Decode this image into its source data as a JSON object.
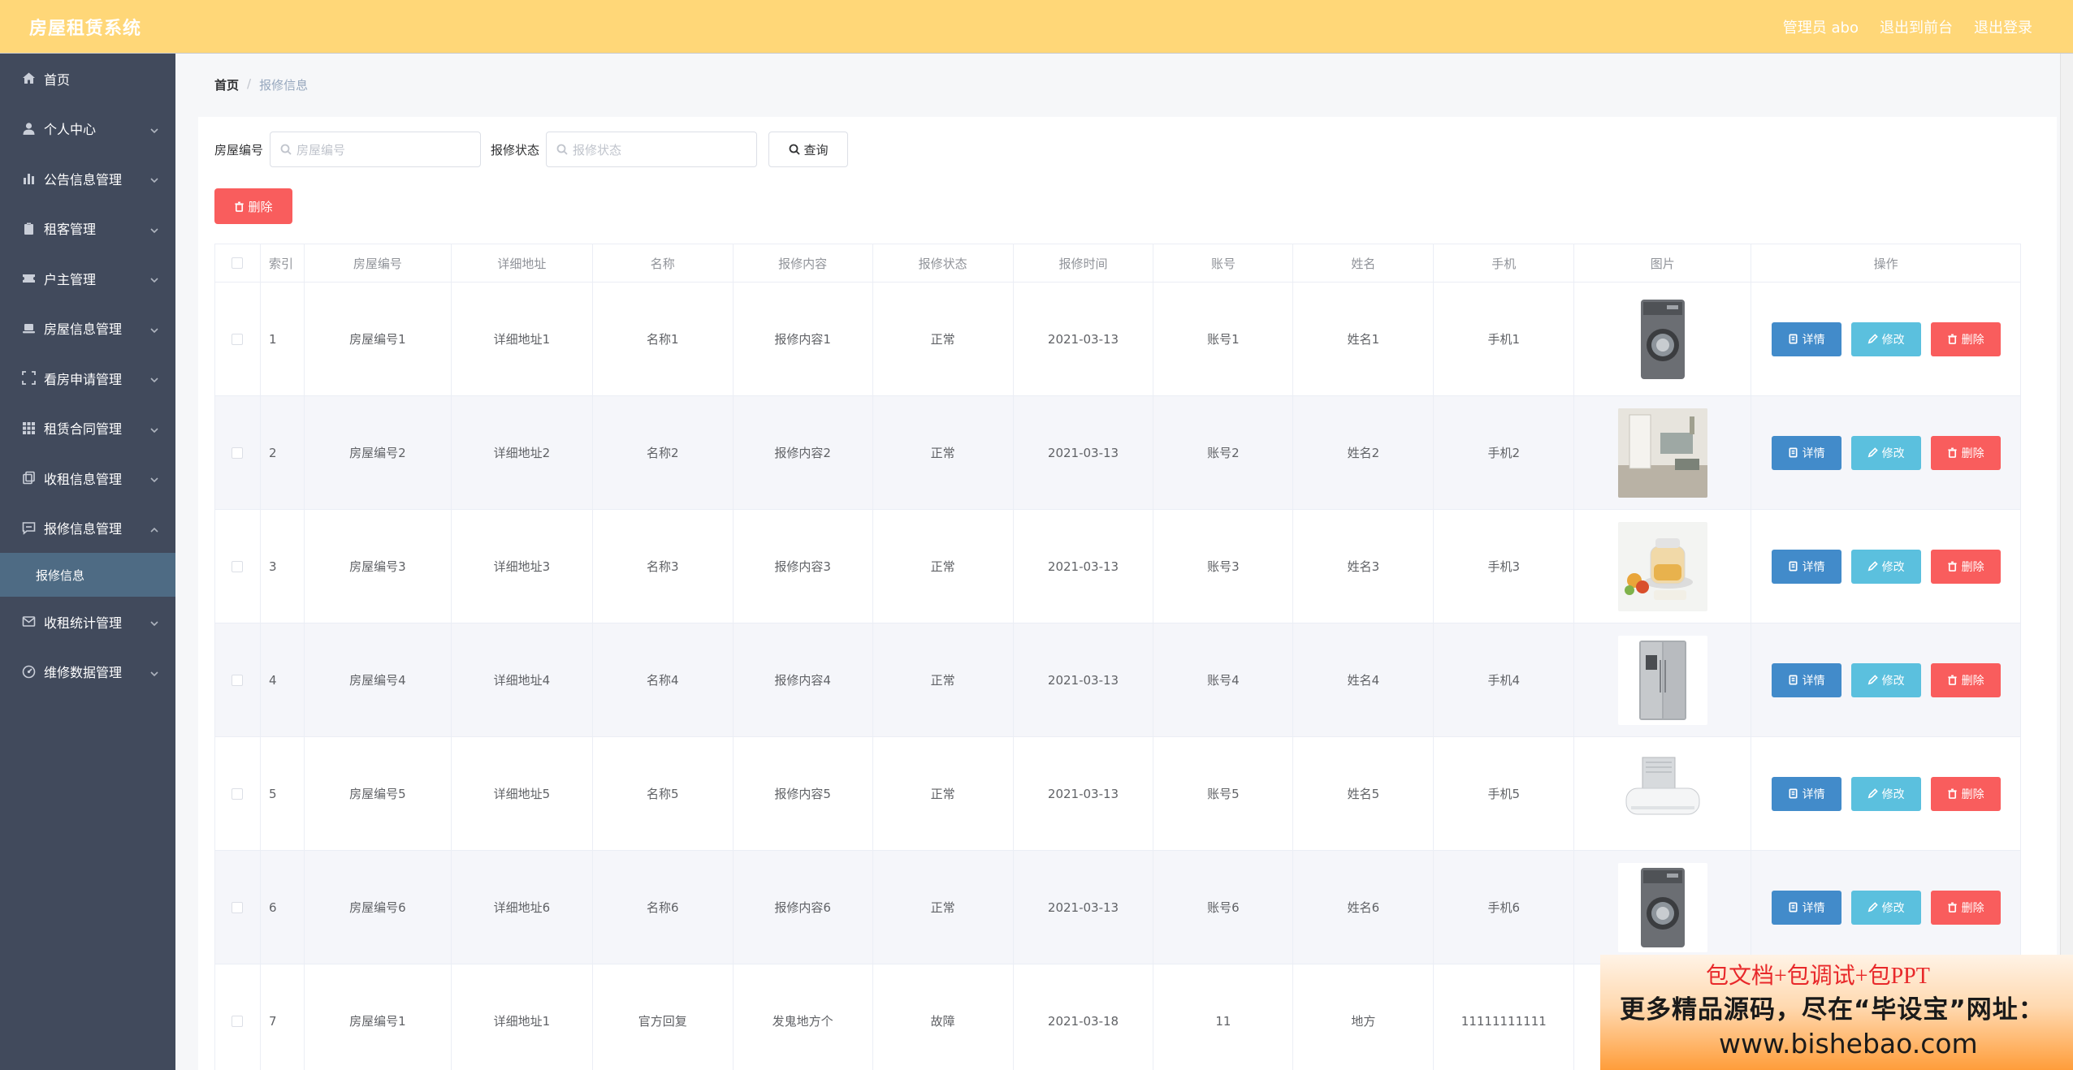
{
  "app": {
    "title": "房屋租赁系统"
  },
  "header": {
    "links": [
      "管理员 abo",
      "退出到前台",
      "退出登录"
    ]
  },
  "sidebar": {
    "items": [
      {
        "label": "首页",
        "icon": "home-icon",
        "arrow": false
      },
      {
        "label": "个人中心",
        "icon": "user-icon",
        "arrow": true
      },
      {
        "label": "公告信息管理",
        "icon": "bar-chart-icon",
        "arrow": true
      },
      {
        "label": "租客管理",
        "icon": "clipboard-icon",
        "arrow": true
      },
      {
        "label": "户主管理",
        "icon": "ticket-icon",
        "arrow": true
      },
      {
        "label": "房屋信息管理",
        "icon": "laptop-icon",
        "arrow": true
      },
      {
        "label": "看房申请管理",
        "icon": "scan-icon",
        "arrow": true
      },
      {
        "label": "租赁合同管理",
        "icon": "grid-icon",
        "arrow": true
      },
      {
        "label": "收租信息管理",
        "icon": "copy-icon",
        "arrow": true
      },
      {
        "label": "报修信息管理",
        "icon": "chat-icon",
        "arrow": true,
        "expanded": true,
        "sub": "报修信息"
      },
      {
        "label": "收租统计管理",
        "icon": "mail-icon",
        "arrow": true
      },
      {
        "label": "维修数据管理",
        "icon": "gauge-icon",
        "arrow": true
      }
    ]
  },
  "breadcrumb": {
    "home": "首页",
    "sep": "/",
    "current": "报修信息"
  },
  "search": {
    "house_label": "房屋编号",
    "house_placeholder": "房屋编号",
    "status_label": "报修状态",
    "status_placeholder": "报修状态",
    "query_label": "查询"
  },
  "toolbar": {
    "delete_label": "删除"
  },
  "table": {
    "headers": [
      "",
      "索引",
      "房屋编号",
      "详细地址",
      "名称",
      "报修内容",
      "报修状态",
      "报修时间",
      "账号",
      "姓名",
      "手机",
      "图片",
      "操作"
    ],
    "actions": {
      "detail": "详情",
      "edit": "修改",
      "delete": "删除"
    },
    "rows": [
      {
        "index": "1",
        "house_no": "房屋编号1",
        "address": "详细地址1",
        "name": "名称1",
        "content": "报修内容1",
        "status": "正常",
        "time": "2021-03-13",
        "account": "账号1",
        "person": "姓名1",
        "phone": "手机1",
        "image": "washing-machine"
      },
      {
        "index": "2",
        "house_no": "房屋编号2",
        "address": "详细地址2",
        "name": "名称2",
        "content": "报修内容2",
        "status": "正常",
        "time": "2021-03-13",
        "account": "账号2",
        "person": "姓名2",
        "phone": "手机2",
        "image": "room-interior"
      },
      {
        "index": "3",
        "house_no": "房屋编号3",
        "address": "详细地址3",
        "name": "名称3",
        "content": "报修内容3",
        "status": "正常",
        "time": "2021-03-13",
        "account": "账号3",
        "person": "姓名3",
        "phone": "手机3",
        "image": "health-kettle"
      },
      {
        "index": "4",
        "house_no": "房屋编号4",
        "address": "详细地址4",
        "name": "名称4",
        "content": "报修内容4",
        "status": "正常",
        "time": "2021-03-13",
        "account": "账号4",
        "person": "姓名4",
        "phone": "手机4",
        "image": "refrigerator"
      },
      {
        "index": "5",
        "house_no": "房屋编号5",
        "address": "详细地址5",
        "name": "名称5",
        "content": "报修内容5",
        "status": "正常",
        "time": "2021-03-13",
        "account": "账号5",
        "person": "姓名5",
        "phone": "手机5",
        "image": "air-conditioner"
      },
      {
        "index": "6",
        "house_no": "房屋编号6",
        "address": "详细地址6",
        "name": "名称6",
        "content": "报修内容6",
        "status": "正常",
        "time": "2021-03-13",
        "account": "账号6",
        "person": "姓名6",
        "phone": "手机6",
        "image": "washing-machine"
      },
      {
        "index": "7",
        "house_no": "房屋编号1",
        "address": "详细地址1",
        "name": "官方回复",
        "content": "发鬼地方个",
        "status": "故障",
        "time": "2021-03-18",
        "account": "11",
        "person": "地方",
        "phone": "11111111111",
        "image": ""
      }
    ]
  },
  "banner": {
    "line1": "包文档+包调试+包PPT",
    "line2": "更多精品源码，尽在“毕设宝”网址：",
    "line3": "www.bishebao.com"
  },
  "colors": {
    "header": "#ffd778",
    "sidebar": "#414a5c",
    "active_sub": "#4e6b84",
    "detail": "#428bca",
    "edit": "#5bc0de",
    "delete": "#f95d5d"
  }
}
